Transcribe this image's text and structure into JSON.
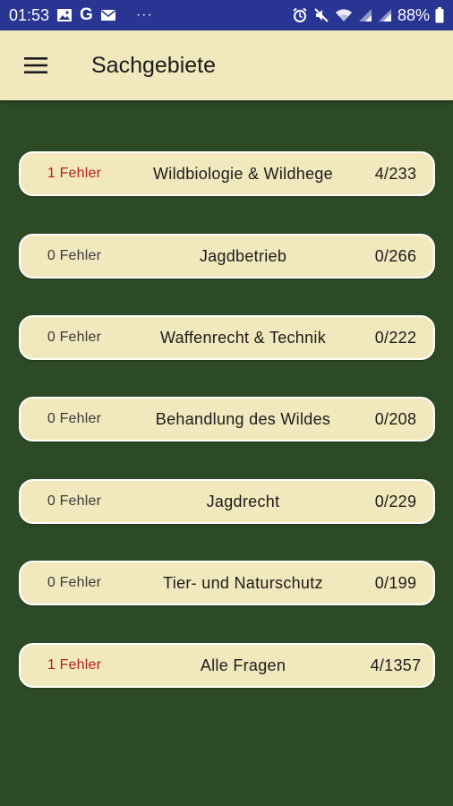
{
  "status_bar": {
    "time": "01:53",
    "overflow": "···",
    "battery": "88%",
    "left_icons": [
      "image-icon",
      "google-g-icon",
      "mail-icon"
    ],
    "right_icons": [
      "alarm-icon",
      "mute-icon",
      "wifi-icon",
      "signal-icon",
      "signal-icon",
      "battery-icon"
    ]
  },
  "app_bar": {
    "title": "Sachgebiete",
    "menu_icon": "hamburger-menu-icon"
  },
  "colors": {
    "background": "#2d4a27",
    "status_bar": "#283593",
    "app_bar": "#f2e8bd",
    "card": "#f2e8bd",
    "error_text": "#b32020"
  },
  "categories": [
    {
      "errors": "1 Fehler",
      "has_errors": true,
      "name": "Wildbiologie & Wildhege",
      "progress": "4/233"
    },
    {
      "errors": "0 Fehler",
      "has_errors": false,
      "name": "Jagdbetrieb",
      "progress": "0/266"
    },
    {
      "errors": "0 Fehler",
      "has_errors": false,
      "name": "Waffenrecht & Technik",
      "progress": "0/222"
    },
    {
      "errors": "0 Fehler",
      "has_errors": false,
      "name": "Behandlung des Wildes",
      "progress": "0/208"
    },
    {
      "errors": "0 Fehler",
      "has_errors": false,
      "name": "Jagdrecht",
      "progress": "0/229"
    },
    {
      "errors": "0 Fehler",
      "has_errors": false,
      "name": "Tier- und Naturschutz",
      "progress": "0/199"
    },
    {
      "errors": "1 Fehler",
      "has_errors": true,
      "name": "Alle Fragen",
      "progress": "4/1357"
    }
  ]
}
